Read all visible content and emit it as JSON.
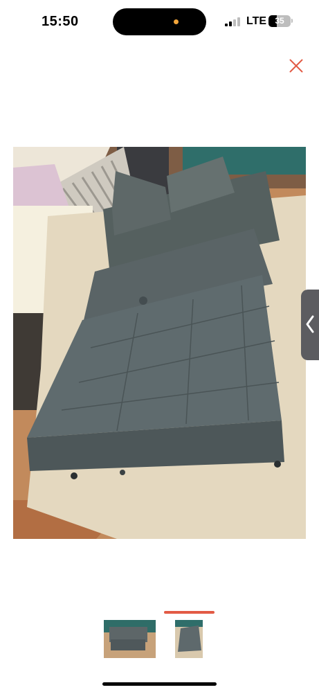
{
  "status_bar": {
    "time": "15:50",
    "network": "LTE",
    "battery_level": "35"
  },
  "viewer": {
    "close_icon": "close-icon",
    "prev_icon": "chevron-left-icon",
    "accent_color": "#e25b45",
    "thumbnails_count": 2,
    "active_thumbnail": 2
  }
}
